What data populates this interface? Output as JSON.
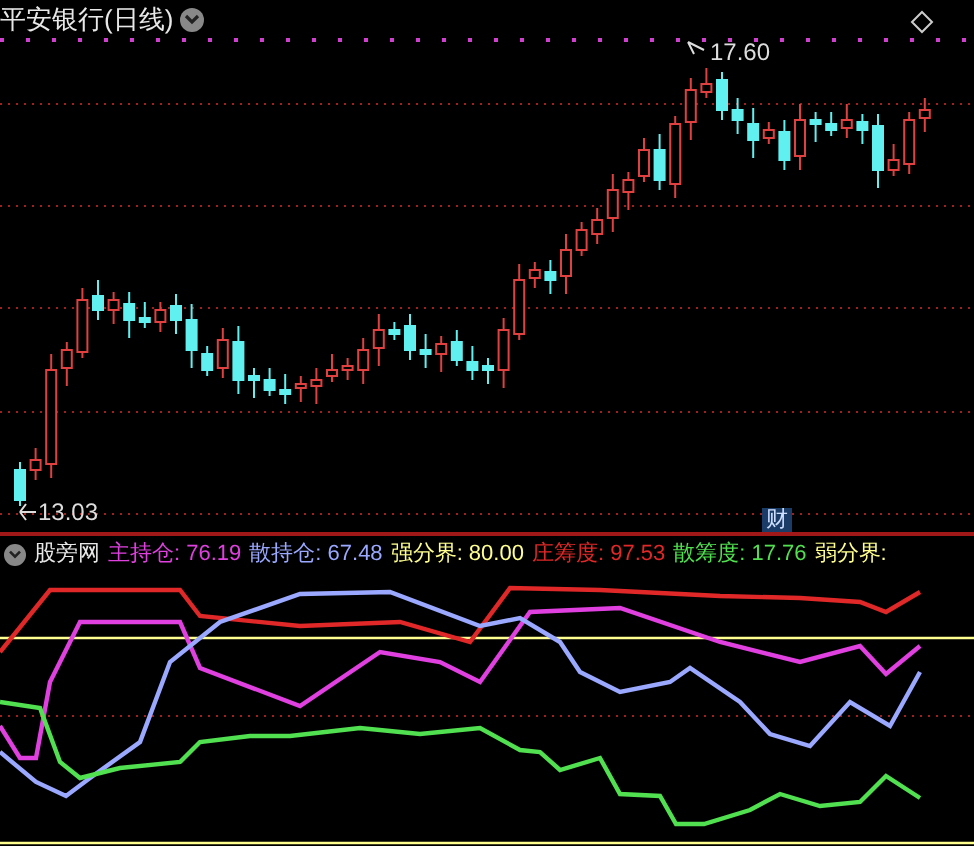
{
  "chart_title": "平安银行(日线)",
  "price_labels": {
    "high": "17.60",
    "low": "13.03"
  },
  "badge": "财",
  "indicator": {
    "name": "股旁网",
    "values": [
      {
        "label": "主持仓:",
        "value": "76.19",
        "color": "#e040e0"
      },
      {
        "label": "散持仓:",
        "value": "67.48",
        "color": "#9aa8ff"
      },
      {
        "label": "强分界:",
        "value": "80.00",
        "color": "#ffff90"
      },
      {
        "label": "庄筹度:",
        "value": "97.53",
        "color": "#e02828"
      },
      {
        "label": "散筹度:",
        "value": "17.76",
        "color": "#50e050"
      },
      {
        "label": "弱分界:",
        "color": "#ffff90"
      }
    ]
  }
}
